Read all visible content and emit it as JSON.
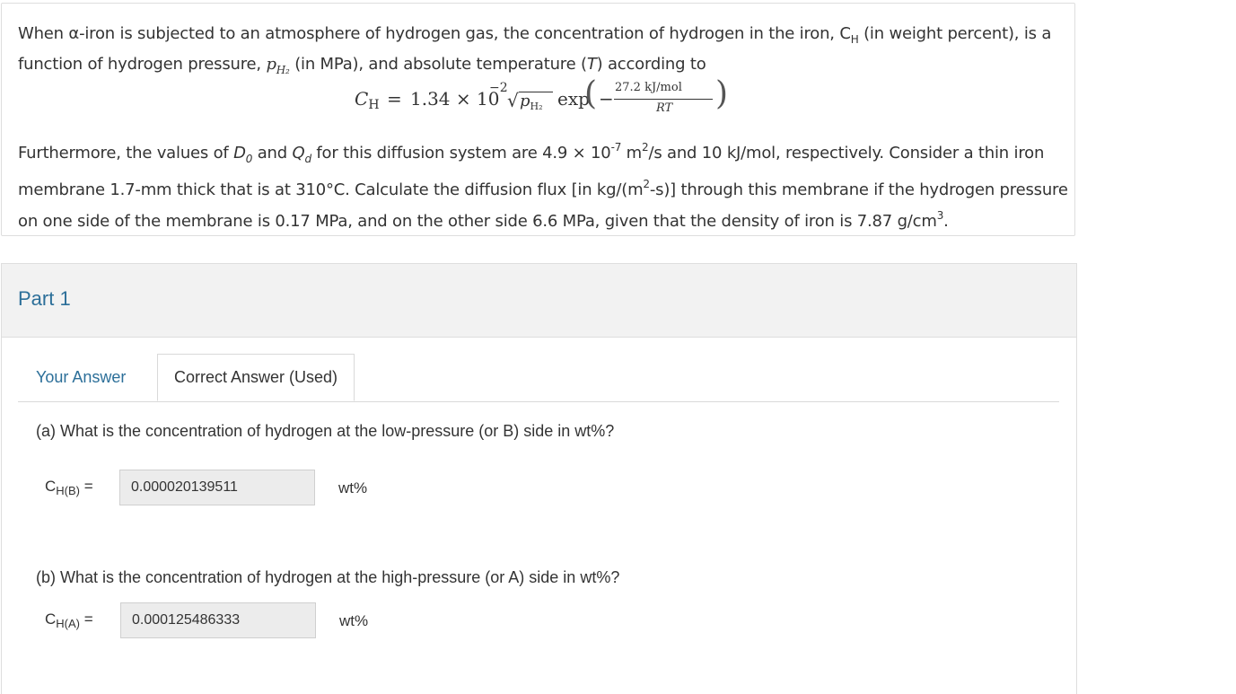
{
  "question": {
    "intro_line1_a": "When α-iron is subjected to an atmosphere of hydrogen gas, the concentration of hydrogen in the iron, ",
    "ch_symbol": "C",
    "ch_sub": "H",
    "intro_line1_b": " (in weight percent), is a function of hydrogen pressure, ",
    "p_symbol": "p",
    "p_sub": "H₂",
    "intro_line2": " (in MPa), and absolute temperature (",
    "t_symbol": "T",
    "intro_end": ") according to",
    "equation": {
      "lhs": "C",
      "lhs_sub": "H",
      "equals": "=",
      "coef": "1.34 × 10",
      "coef_exp": "−2",
      "sqrt_symbol": "√",
      "sqrt_arg": "p",
      "sqrt_arg_sub": "H₂",
      "exp": "exp",
      "minus": "−",
      "numerator": "27.2  kJ/mol",
      "denominator": "RT",
      "open_paren": "(",
      "close_paren": ")"
    },
    "body_a": "Furthermore, the values of ",
    "d_symbol": "D",
    "d_sub": "0",
    "body_b": " and ",
    "q_symbol": "Q",
    "q_sub": "d",
    "body_c": " for this diffusion system are 4.9 × 10",
    "body_exp1": "-7",
    "body_d": " m",
    "body_exp2": "2",
    "body_e": "/s and 10 kJ/mol, respectively. Consider a thin iron membrane 1.7-mm thick that is at 310°C. Calculate the diffusion flux [in kg/(m",
    "body_exp3": "2",
    "body_f": "-s)] through this membrane if the hydrogen pressure on one side of the membrane is 0.17 MPa, and on the other side 6.6 MPa, given that the density of iron is 7.87 g/cm",
    "body_exp4": "3",
    "body_g": "."
  },
  "part": {
    "title": "Part 1",
    "tabs": [
      {
        "label": "Your Answer"
      },
      {
        "label": "Correct Answer (Used)"
      }
    ],
    "a": {
      "question": "(a) What is the concentration of hydrogen at the low-pressure (or B) side in wt%?",
      "label_main": "C",
      "label_sub": "H(B)",
      "label_eq": " =",
      "value": "0.000020139511",
      "unit": "wt%"
    },
    "b": {
      "question": "(b) What is the concentration of hydrogen at the high-pressure (or A) side in wt%?",
      "label_main": "C",
      "label_sub": "H(A)",
      "label_eq": " =",
      "value": "0.000125486333",
      "unit": "wt%"
    }
  }
}
